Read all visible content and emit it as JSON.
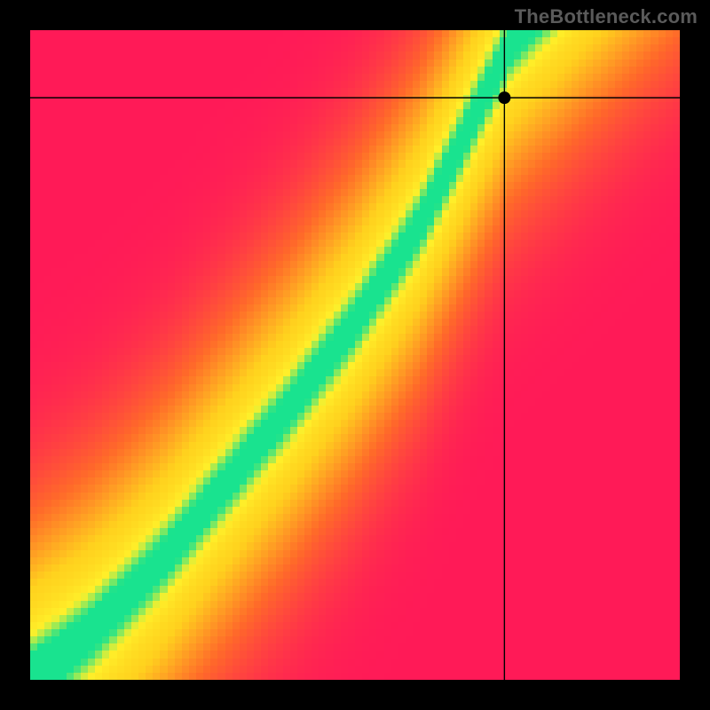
{
  "watermark": "TheBottleneck.com",
  "chart_data": {
    "type": "heatmap",
    "title": "",
    "xlabel": "",
    "ylabel": "",
    "xlim": [
      0,
      100
    ],
    "ylim": [
      0,
      100
    ],
    "grid": false,
    "legend": false,
    "pixel_resolution": 90,
    "colormap": [
      "#ff1a58",
      "#ff6a2a",
      "#ffd21e",
      "#fff02a",
      "#19e38f"
    ],
    "crosshair": {
      "x": 73,
      "y": 89.6
    },
    "marker": {
      "x": 73,
      "y": 89.6,
      "radius_px": 7
    },
    "ridge": {
      "description": "green optimal band runs along y ≈ f(x) with band half-width ≈ 4 units",
      "points": [
        {
          "x": 0,
          "y": 0
        },
        {
          "x": 10,
          "y": 8
        },
        {
          "x": 20,
          "y": 18
        },
        {
          "x": 30,
          "y": 30
        },
        {
          "x": 40,
          "y": 42
        },
        {
          "x": 50,
          "y": 55
        },
        {
          "x": 60,
          "y": 70
        },
        {
          "x": 65,
          "y": 80
        },
        {
          "x": 70,
          "y": 90
        },
        {
          "x": 74,
          "y": 98
        },
        {
          "x": 76,
          "y": 100
        }
      ],
      "band_half_width": 4
    },
    "corner_values_approx": {
      "top_left": "heavy bottleneck (red)",
      "bottom_right": "heavy bottleneck (red)",
      "along_ridge": "balanced (green)"
    }
  }
}
